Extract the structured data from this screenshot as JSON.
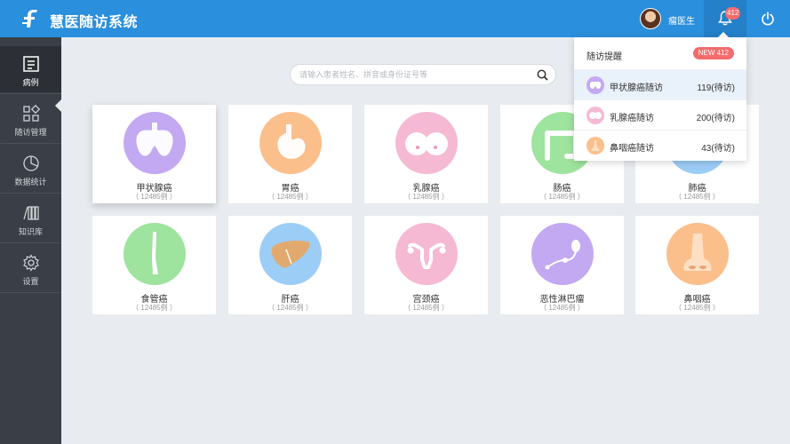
{
  "header": {
    "app_title": "慧医随访系统",
    "user_name": "瘤医生",
    "bell_badge": "412"
  },
  "sidebar": {
    "items": [
      {
        "label": "病例",
        "icon": "case-record-icon"
      },
      {
        "label": "随访管理",
        "icon": "grid-manage-icon"
      },
      {
        "label": "数据统计",
        "icon": "pie-chart-icon"
      },
      {
        "label": "知识库",
        "icon": "books-icon"
      },
      {
        "label": "设置",
        "icon": "gear-icon"
      }
    ]
  },
  "search": {
    "placeholder": "请输入患者姓名、拼音或身份证号等"
  },
  "cards": [
    {
      "name": "甲状腺癌",
      "count": "（ 12485例 ）",
      "color": "#c2a9f2"
    },
    {
      "name": "胃癌",
      "count": "（ 12485例 ）",
      "color": "#fbbf8c"
    },
    {
      "name": "乳腺癌",
      "count": "（ 12485例 ）",
      "color": "#f5b9d3"
    },
    {
      "name": "肠癌",
      "count": "（ 12485例 ）",
      "color": "#9ee39e"
    },
    {
      "name": "肺癌",
      "count": "（ 12485例 ）",
      "color": "#9ccdf7"
    },
    {
      "name": "食管癌",
      "count": "（ 12485例 ）",
      "color": "#9ee39e"
    },
    {
      "name": "肝癌",
      "count": "（ 12485例 ）",
      "color": "#9ccdf7"
    },
    {
      "name": "宫颈癌",
      "count": "（ 12485例 ）",
      "color": "#f5b9d3"
    },
    {
      "name": "恶性淋巴瘤",
      "count": "（ 12485例 ）",
      "color": "#c2a9f2"
    },
    {
      "name": "鼻咽癌",
      "count": "（ 12485例 ）",
      "color": "#fbbf8c"
    }
  ],
  "notifications": {
    "title": "随访提醒",
    "badge": "NEW 412",
    "items": [
      {
        "name": "甲状腺癌随访",
        "value": "119(待访)",
        "color": "#c2a9f2"
      },
      {
        "name": "乳腺癌随访",
        "value": "200(待访)",
        "color": "#f5b9d3"
      },
      {
        "name": "鼻咽癌随访",
        "value": "43(待访)",
        "color": "#fbbf8c"
      }
    ]
  }
}
